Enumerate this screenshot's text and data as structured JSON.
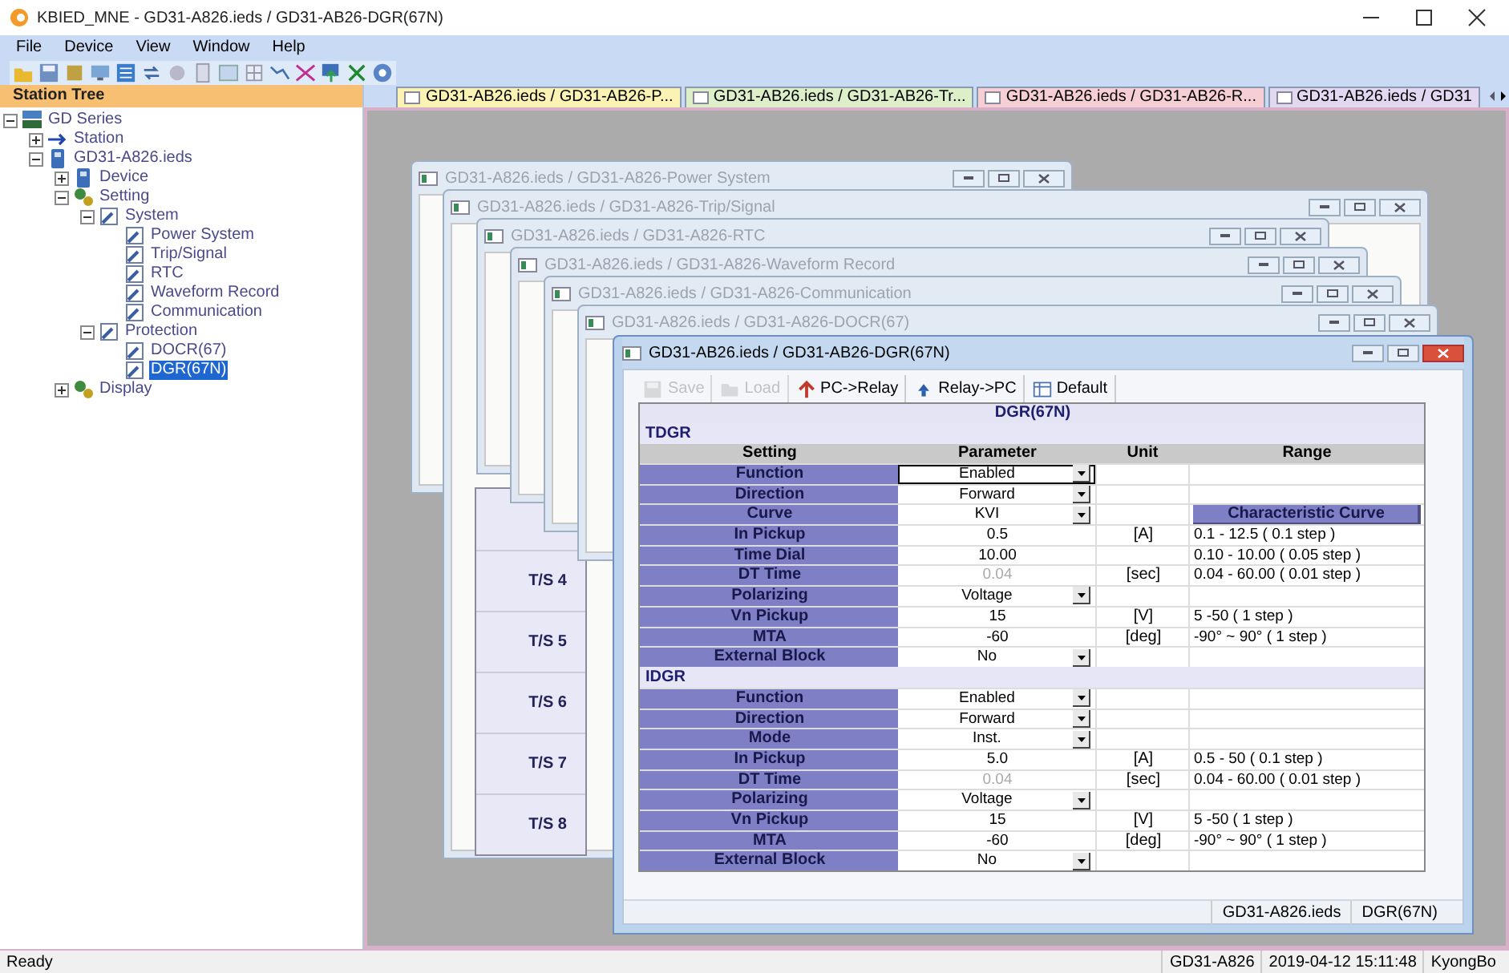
{
  "window": {
    "title": "KBIED_MNE - GD31-A826.ieds / GD31-AB26-DGR(67N)"
  },
  "menu": [
    "File",
    "Device",
    "View",
    "Window",
    "Help"
  ],
  "station_tree": {
    "title": "Station Tree",
    "items": [
      {
        "label": "GD Series",
        "kind": "root",
        "selected": false,
        "expanded": true,
        "children": [
          {
            "label": "Station",
            "kind": "station",
            "selected": false,
            "expanded": false
          },
          {
            "label": "GD31-A826.ieds",
            "kind": "ied",
            "selected": false,
            "expanded": true,
            "children": [
              {
                "label": "Device",
                "kind": "device",
                "selected": false,
                "expanded": false
              },
              {
                "label": "Setting",
                "kind": "setting",
                "selected": false,
                "expanded": true,
                "children": [
                  {
                    "label": "System",
                    "kind": "folder",
                    "selected": false,
                    "expanded": true,
                    "children": [
                      {
                        "label": "Power System",
                        "kind": "page",
                        "selected": false
                      },
                      {
                        "label": "Trip/Signal",
                        "kind": "page",
                        "selected": false
                      },
                      {
                        "label": "RTC",
                        "kind": "page",
                        "selected": false
                      },
                      {
                        "label": "Waveform Record",
                        "kind": "page",
                        "selected": false
                      },
                      {
                        "label": "Communication",
                        "kind": "page",
                        "selected": false
                      }
                    ]
                  },
                  {
                    "label": "Protection",
                    "kind": "folder",
                    "selected": false,
                    "expanded": true,
                    "children": [
                      {
                        "label": "DOCR(67)",
                        "kind": "page",
                        "selected": false
                      },
                      {
                        "label": "DGR(67N)",
                        "kind": "page",
                        "selected": true
                      }
                    ]
                  }
                ]
              },
              {
                "label": "Display",
                "kind": "setting",
                "selected": false,
                "expanded": false
              }
            ]
          }
        ]
      }
    ]
  },
  "tabs": [
    {
      "label": "GD31-AB26.ieds / GD31-AB26-P...",
      "color": "#fbf3b4"
    },
    {
      "label": "GD31-AB26.ieds / GD31-AB26-Tr...",
      "color": "#dcefc8"
    },
    {
      "label": "GD31-AB26.ieds / GD31-AB26-R...",
      "color": "#f6cfd4"
    },
    {
      "label": "GD31-AB26.ieds / GD31",
      "color": "#e3d8f1"
    }
  ],
  "child_windows": [
    {
      "title": "GD31-A826.ieds / GD31-A826-Power System",
      "active": false
    },
    {
      "title": "GD31-A826.ieds / GD31-A826-Trip/Signal",
      "active": false,
      "ts_labels": [
        "T/S 4",
        "T/S 5",
        "T/S 6",
        "T/S 7",
        "T/S 8"
      ]
    },
    {
      "title": "GD31-A826.ieds / GD31-A826-RTC",
      "active": false
    },
    {
      "title": "GD31-A826.ieds / GD31-A826-Waveform Record",
      "active": false
    },
    {
      "title": "GD31-A826.ieds / GD31-A826-Communication",
      "active": false
    },
    {
      "title": "GD31-A826.ieds / GD31-A826-DOCR(67)",
      "active": false
    },
    {
      "title": "GD31-AB26.ieds / GD31-AB26-DGR(67N)",
      "active": true
    }
  ],
  "dgr": {
    "toolbar": [
      {
        "label": "Save",
        "kind": "save",
        "disabled": true
      },
      {
        "label": "Load",
        "kind": "load",
        "disabled": true
      },
      {
        "label": "PC->Relay",
        "kind": "upload",
        "disabled": false
      },
      {
        "label": "Relay->PC",
        "kind": "download",
        "disabled": false
      },
      {
        "label": "Default",
        "kind": "default",
        "disabled": false
      }
    ],
    "table_title": "DGR(67N)",
    "columns": [
      "Setting",
      "Parameter",
      "Unit",
      "Range"
    ],
    "sections": [
      {
        "title": "TDGR",
        "rows": [
          {
            "setting": "Function",
            "parameter": "Enabled",
            "kind": "dropdown",
            "disabled": false,
            "focused": true
          },
          {
            "setting": "Direction",
            "parameter": "Forward",
            "kind": "dropdown",
            "disabled": false,
            "focused": false
          },
          {
            "setting": "Curve",
            "parameter": "KVI",
            "kind": "dropdown",
            "disabled": false,
            "focused": false,
            "range_button": "Characteristic Curve"
          },
          {
            "setting": "In Pickup",
            "parameter": "0.5",
            "kind": "value",
            "disabled": false,
            "focused": false,
            "unit": "[A]",
            "range": "0.1 - 12.5 ( 0.1 step )"
          },
          {
            "setting": "Time Dial",
            "parameter": "10.00",
            "kind": "value",
            "disabled": false,
            "focused": false,
            "range": "0.10 - 10.00 ( 0.05 step )"
          },
          {
            "setting": "DT Time",
            "parameter": "0.04",
            "kind": "value",
            "disabled": true,
            "focused": false,
            "unit": "[sec]",
            "range": "0.04 - 60.00 ( 0.01 step )"
          },
          {
            "setting": "Polarizing",
            "parameter": "Voltage",
            "kind": "dropdown",
            "disabled": false,
            "focused": false
          },
          {
            "setting": "Vn Pickup",
            "parameter": "15",
            "kind": "value",
            "disabled": false,
            "focused": false,
            "unit": "[V]",
            "range": "5 -50 ( 1 step )"
          },
          {
            "setting": "MTA",
            "parameter": "-60",
            "kind": "value",
            "disabled": false,
            "focused": false,
            "unit": "[deg]",
            "range": "-90° ~ 90° ( 1 step )"
          },
          {
            "setting": "External Block",
            "parameter": "No",
            "kind": "dropdown",
            "disabled": false,
            "focused": false
          }
        ]
      },
      {
        "title": "IDGR",
        "rows": [
          {
            "setting": "Function",
            "parameter": "Enabled",
            "kind": "dropdown",
            "disabled": false,
            "focused": false
          },
          {
            "setting": "Direction",
            "parameter": "Forward",
            "kind": "dropdown",
            "disabled": false,
            "focused": false
          },
          {
            "setting": "Mode",
            "parameter": "Inst.",
            "kind": "dropdown",
            "disabled": false,
            "focused": false
          },
          {
            "setting": "In Pickup",
            "parameter": "5.0",
            "kind": "value",
            "disabled": false,
            "focused": false,
            "unit": "[A]",
            "range": "0.5 - 50 ( 0.1 step )"
          },
          {
            "setting": "DT Time",
            "parameter": "0.04",
            "kind": "value",
            "disabled": true,
            "focused": false,
            "unit": "[sec]",
            "range": "0.04 - 60.00 ( 0.01 step )"
          },
          {
            "setting": "Polarizing",
            "parameter": "Voltage",
            "kind": "dropdown",
            "disabled": false,
            "focused": false
          },
          {
            "setting": "Vn Pickup",
            "parameter": "15",
            "kind": "value",
            "disabled": false,
            "focused": false,
            "unit": "[V]",
            "range": "5 -50 ( 1 step )"
          },
          {
            "setting": "MTA",
            "parameter": "-60",
            "kind": "value",
            "disabled": false,
            "focused": false,
            "unit": "[deg]",
            "range": "-90° ~ 90° ( 1 step )"
          },
          {
            "setting": "External Block",
            "parameter": "No",
            "kind": "dropdown",
            "disabled": false,
            "focused": false
          }
        ]
      }
    ],
    "status": [
      "GD31-A826.ieds",
      "DGR(67N)"
    ]
  },
  "status_bar": {
    "message": "Ready",
    "items": [
      "GD31-A826",
      "2019-04-12 15:11:48",
      "KyongBo"
    ]
  }
}
